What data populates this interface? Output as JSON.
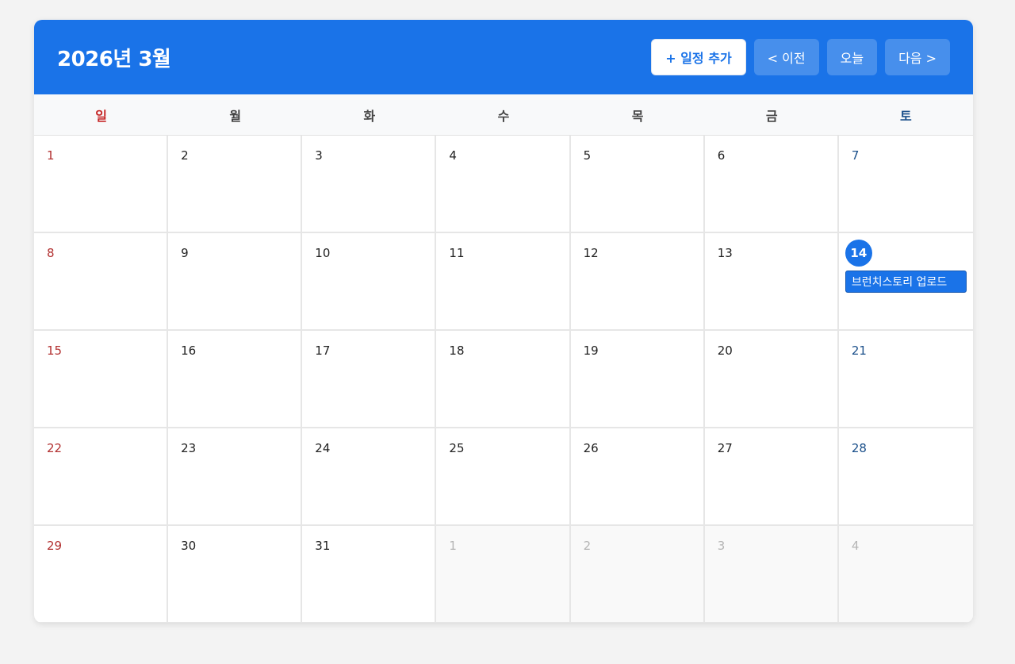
{
  "calendar": {
    "title": "2026년 3월",
    "buttons": {
      "add": "+ 일정 추가",
      "prev": "< 이전",
      "today": "오늘",
      "next": "다음 >"
    },
    "weekdays": [
      "일",
      "월",
      "화",
      "수",
      "목",
      "금",
      "토"
    ],
    "weeks": [
      [
        {
          "day": "1",
          "kind": "sun"
        },
        {
          "day": "2",
          "kind": ""
        },
        {
          "day": "3",
          "kind": ""
        },
        {
          "day": "4",
          "kind": ""
        },
        {
          "day": "5",
          "kind": ""
        },
        {
          "day": "6",
          "kind": ""
        },
        {
          "day": "7",
          "kind": "sat"
        }
      ],
      [
        {
          "day": "8",
          "kind": "sun"
        },
        {
          "day": "9",
          "kind": ""
        },
        {
          "day": "10",
          "kind": ""
        },
        {
          "day": "11",
          "kind": ""
        },
        {
          "day": "12",
          "kind": ""
        },
        {
          "day": "13",
          "kind": ""
        },
        {
          "day": "14",
          "kind": "sat today",
          "events": [
            "브런치스토리 업로드"
          ]
        }
      ],
      [
        {
          "day": "15",
          "kind": "sun"
        },
        {
          "day": "16",
          "kind": ""
        },
        {
          "day": "17",
          "kind": ""
        },
        {
          "day": "18",
          "kind": ""
        },
        {
          "day": "19",
          "kind": ""
        },
        {
          "day": "20",
          "kind": ""
        },
        {
          "day": "21",
          "kind": "sat"
        }
      ],
      [
        {
          "day": "22",
          "kind": "sun"
        },
        {
          "day": "23",
          "kind": ""
        },
        {
          "day": "24",
          "kind": ""
        },
        {
          "day": "25",
          "kind": ""
        },
        {
          "day": "26",
          "kind": ""
        },
        {
          "day": "27",
          "kind": ""
        },
        {
          "day": "28",
          "kind": "sat"
        }
      ],
      [
        {
          "day": "29",
          "kind": "sun"
        },
        {
          "day": "30",
          "kind": ""
        },
        {
          "day": "31",
          "kind": ""
        },
        {
          "day": "1",
          "kind": "other"
        },
        {
          "day": "2",
          "kind": "other"
        },
        {
          "day": "3",
          "kind": "other"
        },
        {
          "day": "4",
          "kind": "other"
        }
      ]
    ]
  },
  "colors": {
    "accent": "#1a73e8",
    "sunday": "#c62828",
    "saturday": "#1a4f8a"
  }
}
